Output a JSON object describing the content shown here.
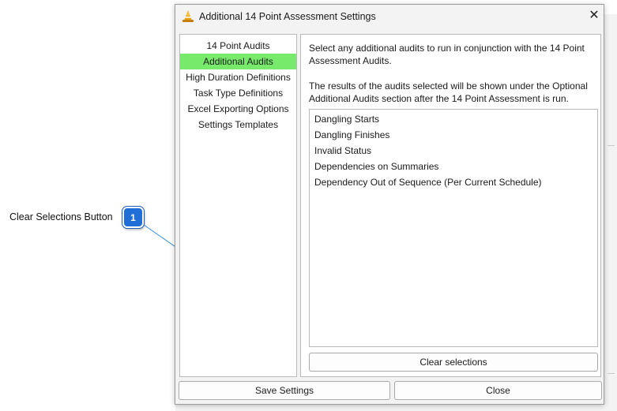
{
  "annotation": {
    "label": "Clear Selections Button",
    "badge_number": "1",
    "badge_color": "#1f6fd6"
  },
  "dialog": {
    "title": "Additional 14 Point Assessment Settings",
    "title_icon": "cone-logo-icon",
    "close_glyph": "✕"
  },
  "nav": {
    "items": [
      {
        "label": "14 Point Audits",
        "active": false
      },
      {
        "label": "Additional Audits",
        "active": true
      },
      {
        "label": "High Duration Definitions",
        "active": false
      },
      {
        "label": "Task Type Definitions",
        "active": false
      },
      {
        "label": "Excel Exporting Options",
        "active": false
      },
      {
        "label": "Settings Templates",
        "active": false
      }
    ],
    "active_color": "#77ea6c"
  },
  "content": {
    "description_1": "Select any additional audits to run in conjunction with the 14 Point Assessment Audits.",
    "description_2": "The results of the audits selected will be shown under the Optional Additional Audits section after the 14 Point Assessment is run.",
    "audits": [
      "Dangling Starts",
      "Dangling Finishes",
      "Invalid Status",
      "Dependencies on Summaries",
      "Dependency Out of Sequence (Per Current Schedule)"
    ],
    "clear_label": "Clear selections"
  },
  "footer": {
    "save_label": "Save Settings",
    "close_label": "Close"
  }
}
